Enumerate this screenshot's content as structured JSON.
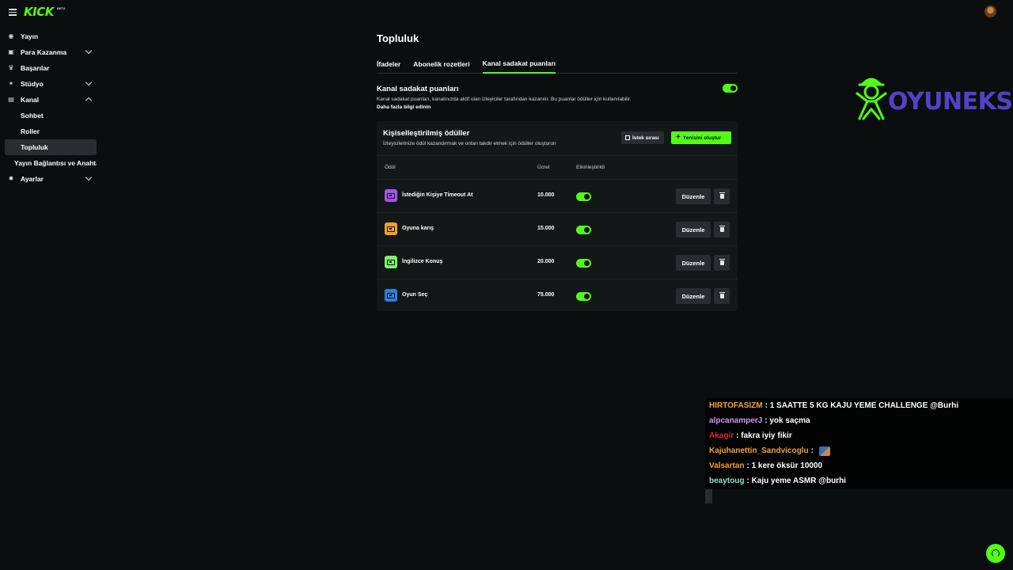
{
  "app": {
    "logo": "KICK",
    "logo_badge": "BETA"
  },
  "sidebar": {
    "items": [
      {
        "label": "Yayın",
        "icon": "broadcast-icon",
        "chevron": "none"
      },
      {
        "label": "Para Kazanma",
        "icon": "wallet-icon",
        "chevron": "down"
      },
      {
        "label": "Başarılar",
        "icon": "trophy-icon",
        "chevron": "none"
      },
      {
        "label": "Stüdyo",
        "icon": "studio-icon",
        "chevron": "down"
      },
      {
        "label": "Kanal",
        "icon": "channel-icon",
        "chevron": "up"
      }
    ],
    "kanal_sub": [
      "Sohbet",
      "Roller",
      "Topluluk"
    ],
    "stream_key": "Yayın Bağlantısı ve Anahtarı",
    "settings": "Ayarlar"
  },
  "main": {
    "title": "Topluluk",
    "tabs": [
      "İfadeler",
      "Abonelik rozetleri",
      "Kanal sadakat puanları"
    ],
    "active_tab": "Kanal sadakat puanları",
    "section": {
      "title": "Kanal sadakat puanları",
      "description": "Kanal sadakat puanları, kanalınızda aktif olan izleyiciler tarafından kazanılır. Bu puanlar ödüller için kullanılabilir.",
      "link": "Daha fazla bilgi edinin",
      "enabled": true
    },
    "rewards_panel": {
      "title": "Kişiselleştirilmiş ödüller",
      "description": "İzleyicilerinize ödül kazandırmak ve onları takdir etmek için ödüller oluşturun",
      "queue_button": "İstek sırası",
      "create_button": "Yenisini oluştur",
      "columns": {
        "reward": "Ödül",
        "cost": "Ücret",
        "enabled": "Etkinleştirildi"
      },
      "edit_label": "Düzenle",
      "rows": [
        {
          "name": "İstediğin Kişiye Timeout At",
          "cost": "10.000",
          "color": "#a654ea",
          "enabled": true
        },
        {
          "name": "Oyuna karış",
          "cost": "15.000",
          "color": "#f0a22b",
          "enabled": true
        },
        {
          "name": "İngilizce Konuş",
          "cost": "20.000",
          "color": "#7cf26a",
          "enabled": true
        },
        {
          "name": "Oyun Seç",
          "cost": "75.000",
          "color": "#2f7fdc",
          "enabled": true
        }
      ]
    }
  },
  "overlay_logo": {
    "text": "OYUNEKS",
    "color": "#5640c9",
    "mascot_color": "#53fc18"
  },
  "chat": [
    {
      "user": "HIRTOFASIZM",
      "color": "#f5a23a",
      "message": "1 SAATTE 5 KG KAJU YEME CHALLENGE @Burhi"
    },
    {
      "user": "alpcanamperJ",
      "color": "#c79cf5",
      "message": "yok saçma"
    },
    {
      "user": "Akagir",
      "color": "#e0263d",
      "message": "fakra iyiy fikir"
    },
    {
      "user": "Kajuhanettin_Sandvicoglu",
      "color": "#f5a23a",
      "message": "",
      "emote": true
    },
    {
      "user": "Valsartan",
      "color": "#f5a23a",
      "message": "1 kere öksür 10000"
    },
    {
      "user": "beaytoug",
      "color": "#8ee0d0",
      "message": "Kaju yeme ASMR @burhi"
    }
  ],
  "colors": {
    "accent": "#53fc18",
    "background": "#0b0e0f",
    "panel": "#141718"
  }
}
